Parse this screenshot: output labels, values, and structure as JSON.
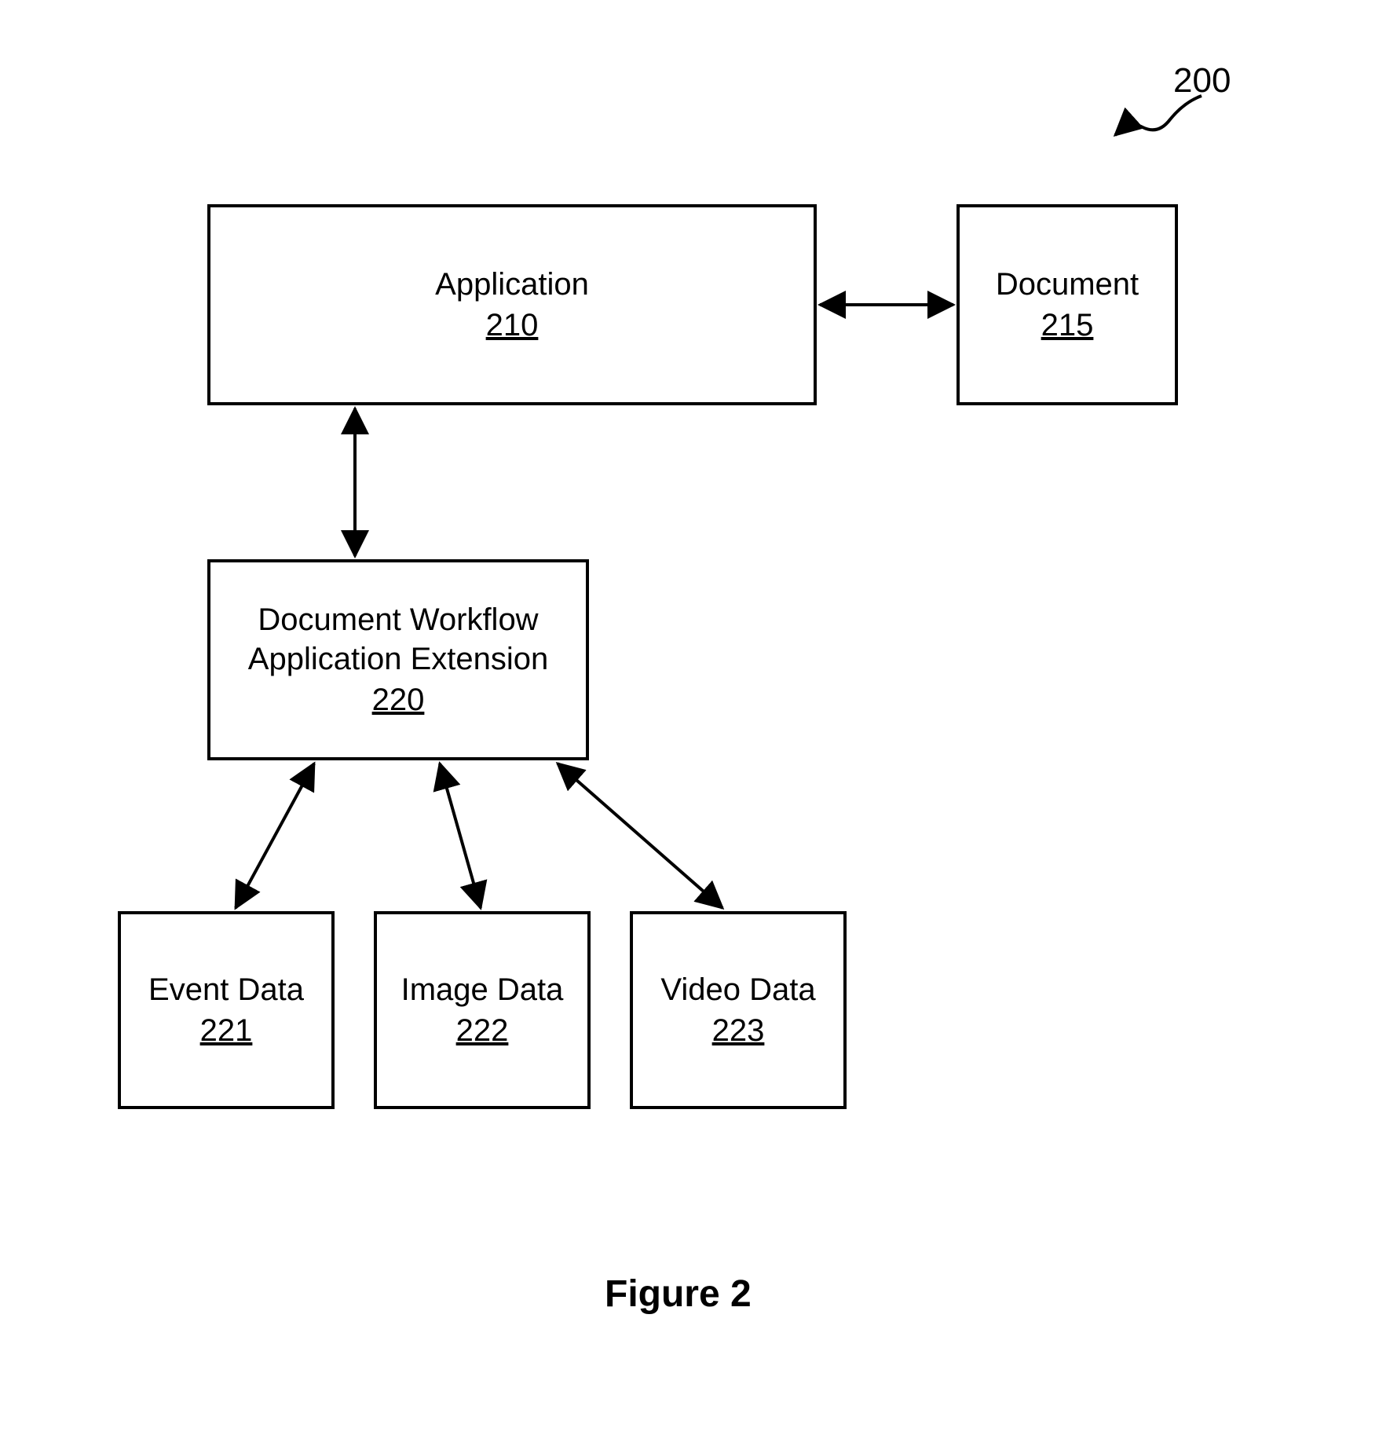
{
  "diagram": {
    "cornerRef": "200",
    "caption": "Figure 2",
    "boxes": {
      "application": {
        "label": "Application",
        "ref": "210"
      },
      "document": {
        "label": "Document",
        "ref": "215"
      },
      "extension": {
        "label": "Document Workflow\nApplication Extension",
        "ref": "220"
      },
      "event": {
        "label": "Event Data",
        "ref": "221"
      },
      "image": {
        "label": "Image Data",
        "ref": "222"
      },
      "video": {
        "label": "Video Data",
        "ref": "223"
      }
    }
  }
}
